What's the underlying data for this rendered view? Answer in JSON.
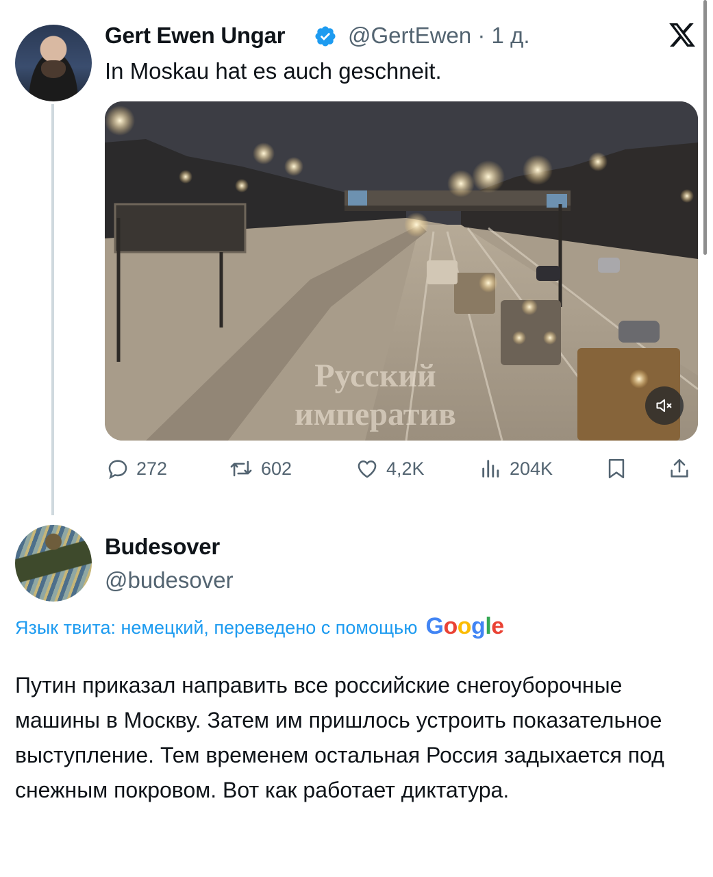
{
  "tweet": {
    "author_name": "Gert Ewen Ungar",
    "author_meta": "@GertEwen · 1 д.",
    "text": "In Moskau hat es auch geschneit.",
    "media": {
      "watermark_line1": "Русский",
      "watermark_line2": "императив",
      "mute_icon": "speaker-muted-icon"
    },
    "stats": {
      "replies": "272",
      "retweets": "602",
      "likes": "4,2K",
      "views": "204K"
    }
  },
  "reply": {
    "author_name": "Budesover",
    "author_handle": "@budesover",
    "translation_note": "Язык твита: немецкий, переведено с помощью",
    "translation_provider": [
      "G",
      "o",
      "o",
      "g",
      "l",
      "e"
    ],
    "text": "Путин приказал направить все российские снегоуборочные машины в Москву. Затем им пришлось устроить показательное выступление. Тем временем остальная Россия задыхается под снежным покровом. Вот как работает диктатура."
  },
  "colors": {
    "link_blue": "#1d9bf0",
    "secondary_text": "#536471",
    "primary_text": "#0f1419"
  }
}
